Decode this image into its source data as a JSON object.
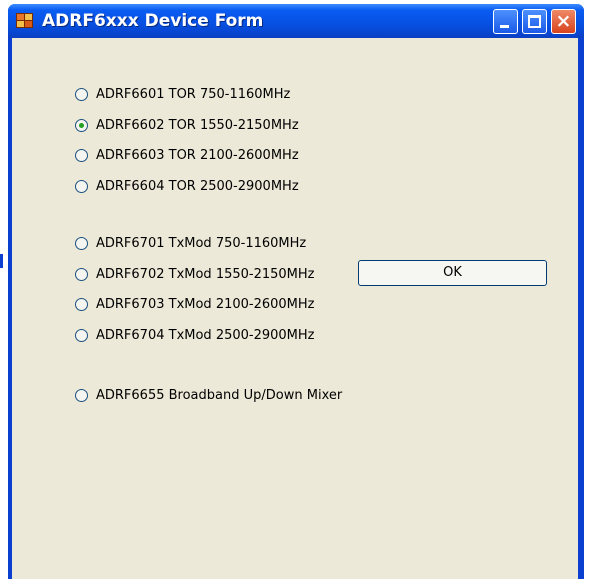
{
  "window": {
    "title": "ADRF6xxx Device Form",
    "buttons": {
      "minimize": "minimize",
      "maximize": "maximize",
      "close": "×"
    }
  },
  "options": [
    {
      "label": "ADRF6601 TOR 750-1160MHz",
      "checked": false
    },
    {
      "label": "ADRF6602 TOR 1550-2150MHz",
      "checked": true
    },
    {
      "label": "ADRF6603 TOR 2100-2600MHz",
      "checked": false
    },
    {
      "label": "ADRF6604 TOR 2500-2900MHz",
      "checked": false
    },
    {
      "label": "ADRF6701 TxMod 750-1160MHz",
      "checked": false
    },
    {
      "label": "ADRF6702 TxMod 1550-2150MHz",
      "checked": false
    },
    {
      "label": "ADRF6703 TxMod 2100-2600MHz",
      "checked": false
    },
    {
      "label": "ADRF6704 TxMod 2500-2900MHz",
      "checked": false
    },
    {
      "label": "ADRF6655 Broadband Up/Down Mixer",
      "checked": false
    }
  ],
  "ok_button": "OK",
  "colors": {
    "titlebar": "#0a5cf2",
    "client": "#ece9d8",
    "radio_dot": "#21a121"
  }
}
